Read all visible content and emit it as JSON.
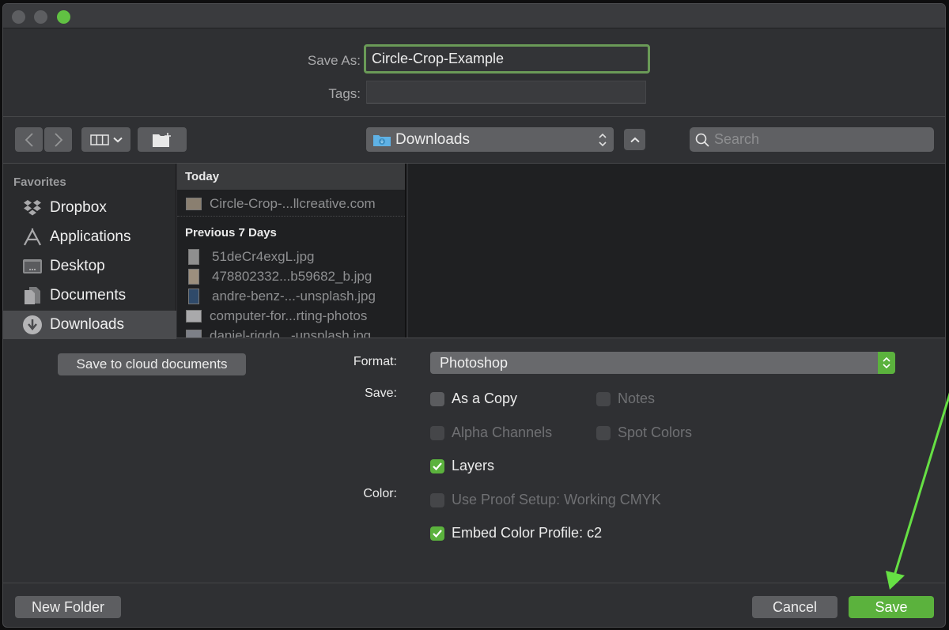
{
  "window": {
    "traffic_lights": [
      "close",
      "minimize",
      "zoom"
    ],
    "colors": {
      "accent": "#5bb23d",
      "focus_ring": "#6a9a57",
      "annotation_arrow": "#66e044"
    }
  },
  "header": {
    "save_as_label": "Save As:",
    "save_as_value": "Circle-Crop-Example",
    "tags_label": "Tags:",
    "tags_value": ""
  },
  "toolbar": {
    "back_icon": "chevron-left-icon",
    "forward_icon": "chevron-right-icon",
    "view_icon": "column-view-icon",
    "new_folder_icon": "folder-plus-icon",
    "location": "Downloads",
    "location_icon": "downloads-folder-icon",
    "up_icon": "chevron-up-icon",
    "search_placeholder": "Search"
  },
  "sidebar": {
    "heading": "Favorites",
    "items": [
      {
        "label": "Dropbox",
        "icon": "dropbox-icon",
        "selected": false
      },
      {
        "label": "Applications",
        "icon": "applications-icon",
        "selected": false
      },
      {
        "label": "Desktop",
        "icon": "desktop-icon",
        "selected": false
      },
      {
        "label": "Documents",
        "icon": "documents-icon",
        "selected": false
      },
      {
        "label": "Downloads",
        "icon": "downloads-icon",
        "selected": true
      }
    ]
  },
  "files": {
    "groups": [
      {
        "label": "Today",
        "items": [
          "Circle-Crop-...llcreative.com"
        ]
      },
      {
        "label": "Previous 7 Days",
        "items": [
          "51deCr4exgL.jpg",
          "478802332...b59682_b.jpg",
          "andre-benz-...-unsplash.jpg",
          "computer-for...rting-photos",
          "daniel-rigdo...-unsplash.jpg"
        ]
      }
    ]
  },
  "options": {
    "cloud_button": "Save to cloud documents",
    "format_label": "Format:",
    "format_value": "Photoshop",
    "save_label": "Save:",
    "color_label": "Color:",
    "checkboxes": {
      "as_a_copy": {
        "label": "As a Copy",
        "checked": false,
        "enabled": true
      },
      "notes": {
        "label": "Notes",
        "checked": false,
        "enabled": false
      },
      "alpha_channels": {
        "label": "Alpha Channels",
        "checked": false,
        "enabled": false
      },
      "spot_colors": {
        "label": "Spot Colors",
        "checked": false,
        "enabled": false
      },
      "layers": {
        "label": "Layers",
        "checked": true,
        "enabled": true
      },
      "use_proof_setup": {
        "label": "Use Proof Setup:  Working CMYK",
        "checked": false,
        "enabled": false
      },
      "embed_color_profile": {
        "label": "Embed Color Profile:  c2",
        "checked": true,
        "enabled": true
      }
    }
  },
  "footer": {
    "new_folder": "New Folder",
    "cancel": "Cancel",
    "save": "Save"
  }
}
